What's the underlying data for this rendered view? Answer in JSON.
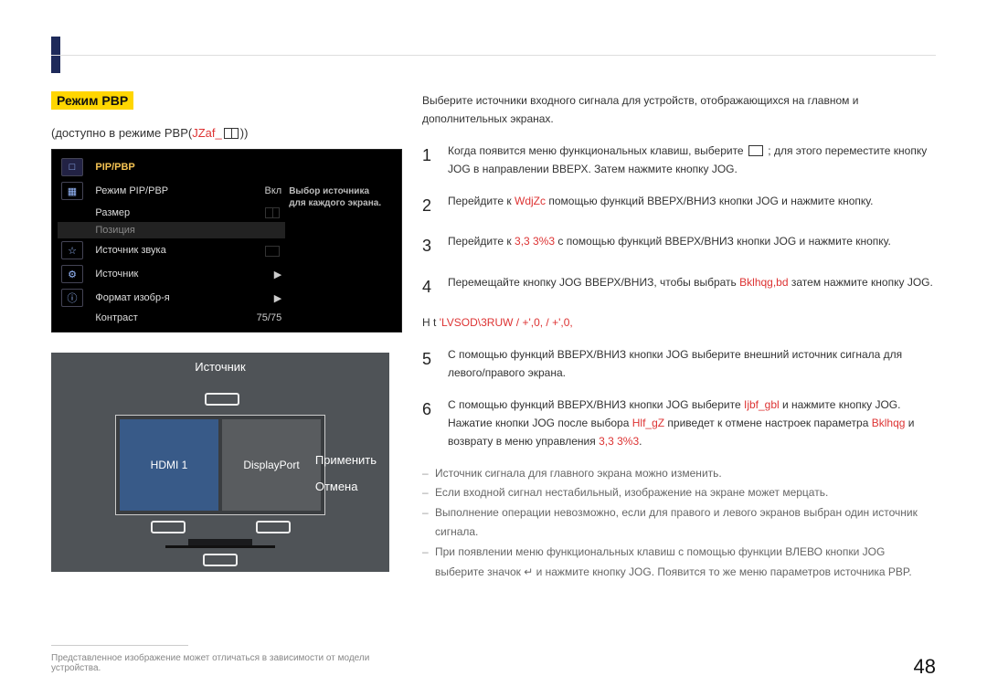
{
  "page_number": "48",
  "left": {
    "title": "Режим PBP",
    "subtitle_prefix": "(доступно в режиме PBP(",
    "subtitle_red": "JZaf_",
    "subtitle_suffix": "))",
    "osd": {
      "heading": "PIP/PBP",
      "tip_title": "Выбор источника",
      "tip_body": "для каждого экрана.",
      "rows": [
        {
          "label": "Режим PIP/PBP",
          "value": "Вкл"
        },
        {
          "label": "Размер",
          "value": ""
        },
        {
          "label": "Позиция",
          "value": ""
        },
        {
          "label": "Источник звука",
          "value": ""
        },
        {
          "label": "Источник",
          "value": "▶"
        },
        {
          "label": "Формат изобр-я",
          "value": "▶"
        },
        {
          "label": "Контраст",
          "value": "75/75"
        }
      ]
    },
    "preview": {
      "header": "Источник",
      "left_label": "HDMI 1",
      "right_label": "DisplayPort",
      "apply": "Применить",
      "cancel": "Отмена"
    },
    "footnote": "Представленное изображение может отличаться в зависимости от модели устройства."
  },
  "right": {
    "intro": "Выберите источники входного сигнала для устройств, отображающихся на главном и дополнительных экранах.",
    "steps": [
      {
        "n": "1",
        "pre": "Когда появится меню функциональных клавиш, выберите ",
        "icon": "menu",
        "post": " ; для этого переместите кнопку JOG в направлении ВВЕРХ. Затем нажмите кнопку JOG."
      },
      {
        "n": "2",
        "pre": "Перейдите к ",
        "red": "WdjZc",
        "post": " помощью функций ВВЕРХ/ВНИЗ кнопки JOG и нажмите кнопку."
      },
      {
        "n": "3",
        "pre": "Перейдите к ",
        "red": "3,3 3%3",
        "post": " с помощью функций ВВЕРХ/ВНИЗ кнопки JOG и нажмите кнопку."
      },
      {
        "n": "4",
        "pre": "Перемещайте кнопку JOG ВВЕРХ/ВНИЗ, чтобы выбрать ",
        "red": "Bklhqg,bd",
        "post": " затем нажмите кнопку JOG."
      }
    ],
    "mid_prefix": "H t",
    "mid_red": "'LVSOD\\3RUW",
    "mid_slash": " / ",
    "mid_red2": "+',0,",
    "mid_red3": "+',0,",
    "step5": {
      "n": "5",
      "text": "С помощью функций ВВЕРХ/ВНИЗ кнопки JOG выберите внешний источник сигнала для левого/правого экрана."
    },
    "step6": {
      "n": "6",
      "pre": "С помощью функций ВВЕРХ/ВНИЗ кнопки JOG выберите ",
      "red1": "Ijbf_gbl",
      "mid1": " и нажмите кнопку JOG. Нажатие кнопки JOG после выбора ",
      "red2": "Hlf_gZ",
      "mid2": " приведет к отмене настроек параметра ",
      "red3": "Bklhqg",
      "mid3": " и возврату в меню управления ",
      "red4": "3,3 3%3",
      "post": "."
    },
    "notes": [
      "Источник сигнала для главного экрана можно изменить.",
      "Если входной сигнал нестабильный, изображение на экране может мерцать.",
      "Выполнение операции невозможно, если для правого и левого экранов выбран один источник сигнала.",
      "При появлении меню функциональных клавиш с помощью функции ВЛЕВО кнопки JOG выберите значок ↵ и нажмите кнопку JOG. Появится то же меню параметров источника PBP."
    ]
  }
}
